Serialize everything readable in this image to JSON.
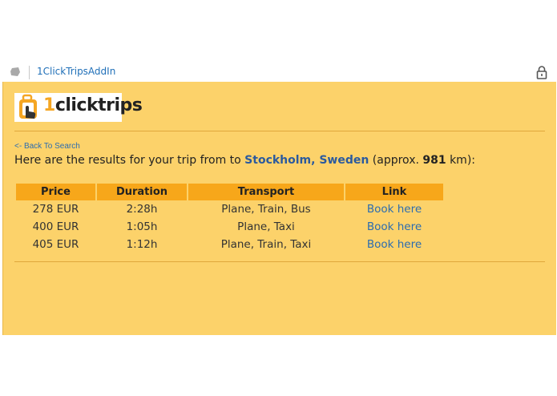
{
  "addin": {
    "title": "1ClickTripsAddIn",
    "icon": "addin-icon",
    "lock_icon": "lock-icon"
  },
  "logo": {
    "text_one": "1",
    "text_rest": "clicktrips",
    "icon": "luggage-hand-icon"
  },
  "back_link": "<- Back To Search",
  "intro": {
    "prefix": "Here are the results for your trip from to ",
    "destination": "Stockholm, Sweden",
    "middle": " (approx. ",
    "distance": "981",
    "suffix": " km):"
  },
  "table": {
    "headers": [
      "Price",
      "Duration",
      "Transport",
      "Link"
    ],
    "rows": [
      {
        "price": "278 EUR",
        "duration": "2:28h",
        "transport": "Plane, Train, Bus",
        "link": "Book here"
      },
      {
        "price": "400 EUR",
        "duration": "1:05h",
        "transport": "Plane, Taxi",
        "link": "Book here"
      },
      {
        "price": "405 EUR",
        "duration": "1:12h",
        "transport": "Plane, Train, Taxi",
        "link": "Book here"
      }
    ]
  },
  "colors": {
    "panel_bg": "#fcd26a",
    "header_bg": "#f7a71a",
    "link": "#2b6cb0",
    "accent": "#f5a623"
  }
}
